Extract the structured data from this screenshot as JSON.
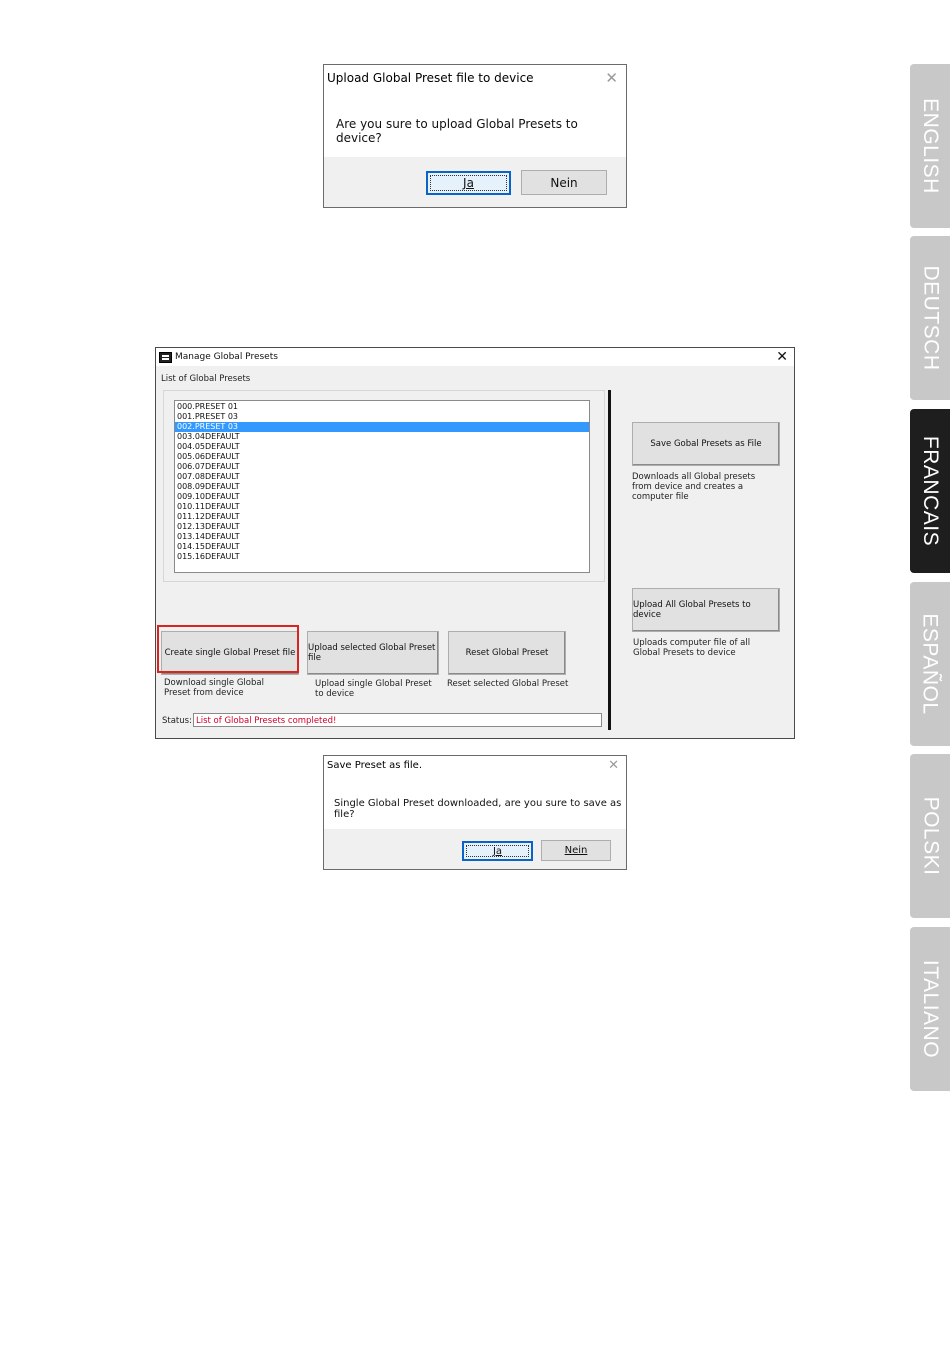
{
  "lang_tabs": [
    {
      "label": "ENGLISH",
      "active": false
    },
    {
      "label": "DEUTSCH",
      "active": false
    },
    {
      "label": "FRANCAIS",
      "active": true
    },
    {
      "label": "ESPAÑOL",
      "active": false
    },
    {
      "label": "POLSKI",
      "active": false
    },
    {
      "label": "ITALIANO",
      "active": false
    }
  ],
  "dialog_upload": {
    "title": "Upload Global Preset file to device",
    "message": "Are you sure to upload Global Presets to device?",
    "yes_label": "Ja",
    "no_label": "Nein"
  },
  "manage_window": {
    "title": "Manage Global Presets",
    "close_glyph": "✕",
    "list_label": "List of Global Presets",
    "presets": [
      "000.PRESET 01",
      "001.PRESET 03",
      "002.PRESET 03",
      "003.04DEFAULT",
      "004.05DEFAULT",
      "005.06DEFAULT",
      "006.07DEFAULT",
      "007.08DEFAULT",
      "008.09DEFAULT",
      "009.10DEFAULT",
      "010.11DEFAULT",
      "011.12DEFAULT",
      "012.13DEFAULT",
      "013.14DEFAULT",
      "014.15DEFAULT",
      "015.16DEFAULT"
    ],
    "selected_index": 2,
    "save_all_label": "Save Gobal Presets as File",
    "save_all_desc": "Downloads all Global presets from device and creates a computer file",
    "upload_all_label": "Upload All Global Presets to device",
    "upload_all_desc": "Uploads computer file of all Global Presets to device",
    "create_single_label": "Create single Global Preset file",
    "create_single_desc": "Download single Global Preset from device",
    "upload_selected_label": "Upload selected Global Preset file",
    "upload_selected_desc": "Upload single Global Preset to device",
    "reset_label": "Reset Global Preset",
    "reset_desc": "Reset selected Global Preset",
    "status_label": "Status:",
    "status_value": "List of Global Presets completed!",
    "status_color": "#d1002a",
    "highlight_color": "#d9241f"
  },
  "dialog_save": {
    "title": "Save Preset as file.",
    "message": "Single Global Preset downloaded, are you sure to save as file?",
    "yes_label": "Ja",
    "no_label": "Nein"
  }
}
